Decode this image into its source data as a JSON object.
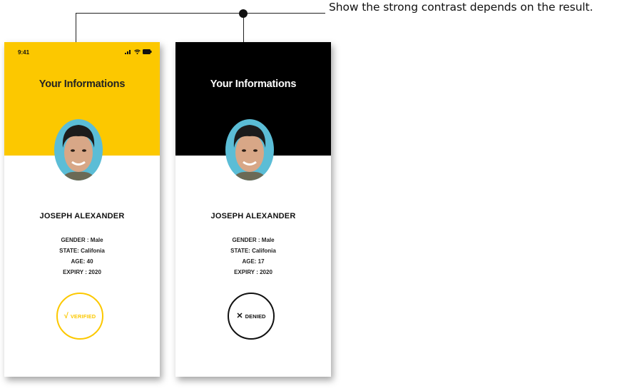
{
  "annotation": {
    "text": "Show the strong contrast depends on the result."
  },
  "status_bar": {
    "time": "9:41"
  },
  "screen_title": "Your Informations",
  "screens": {
    "verified": {
      "header_color": "#fcc800",
      "name": "JOSEPH ALEXANDER",
      "gender": "GENDER : Male",
      "state": "STATE: Califonia",
      "age": "AGE: 40",
      "expiry": "EXPIRY : 2020",
      "badge_label": "VERIFIED",
      "badge_icon": "check-icon",
      "badge_glyph": "√",
      "badge_color": "#fcc800"
    },
    "denied": {
      "header_color": "#000000",
      "name": "JOSEPH ALEXANDER",
      "gender": "GENDER : Male",
      "state": "STATE: Califonia",
      "age": "AGE: 17",
      "expiry": "EXPIRY : 2020",
      "badge_label": "DENIED",
      "badge_icon": "close-icon",
      "badge_glyph": "✕",
      "badge_color": "#111111"
    }
  }
}
